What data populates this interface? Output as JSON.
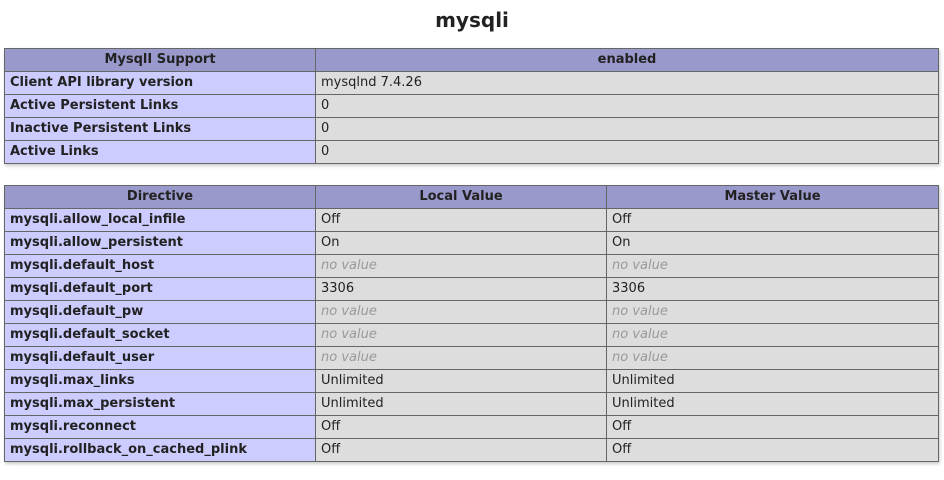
{
  "title": "mysqli",
  "support_table": {
    "header": {
      "label": "MysqlI Support",
      "value": "enabled"
    },
    "rows": [
      {
        "label": "Client API library version",
        "value": "mysqlnd 7.4.26"
      },
      {
        "label": "Active Persistent Links",
        "value": "0"
      },
      {
        "label": "Inactive Persistent Links",
        "value": "0"
      },
      {
        "label": "Active Links",
        "value": "0"
      }
    ]
  },
  "directive_table": {
    "headers": [
      "Directive",
      "Local Value",
      "Master Value"
    ],
    "rows": [
      {
        "directive": "mysqli.allow_local_infile",
        "local": "Off",
        "master": "Off"
      },
      {
        "directive": "mysqli.allow_persistent",
        "local": "On",
        "master": "On"
      },
      {
        "directive": "mysqli.default_host",
        "local": "no value",
        "master": "no value"
      },
      {
        "directive": "mysqli.default_port",
        "local": "3306",
        "master": "3306"
      },
      {
        "directive": "mysqli.default_pw",
        "local": "no value",
        "master": "no value"
      },
      {
        "directive": "mysqli.default_socket",
        "local": "no value",
        "master": "no value"
      },
      {
        "directive": "mysqli.default_user",
        "local": "no value",
        "master": "no value"
      },
      {
        "directive": "mysqli.max_links",
        "local": "Unlimited",
        "master": "Unlimited"
      },
      {
        "directive": "mysqli.max_persistent",
        "local": "Unlimited",
        "master": "Unlimited"
      },
      {
        "directive": "mysqli.reconnect",
        "local": "Off",
        "master": "Off"
      },
      {
        "directive": "mysqli.rollback_on_cached_plink",
        "local": "Off",
        "master": "Off"
      }
    ]
  }
}
